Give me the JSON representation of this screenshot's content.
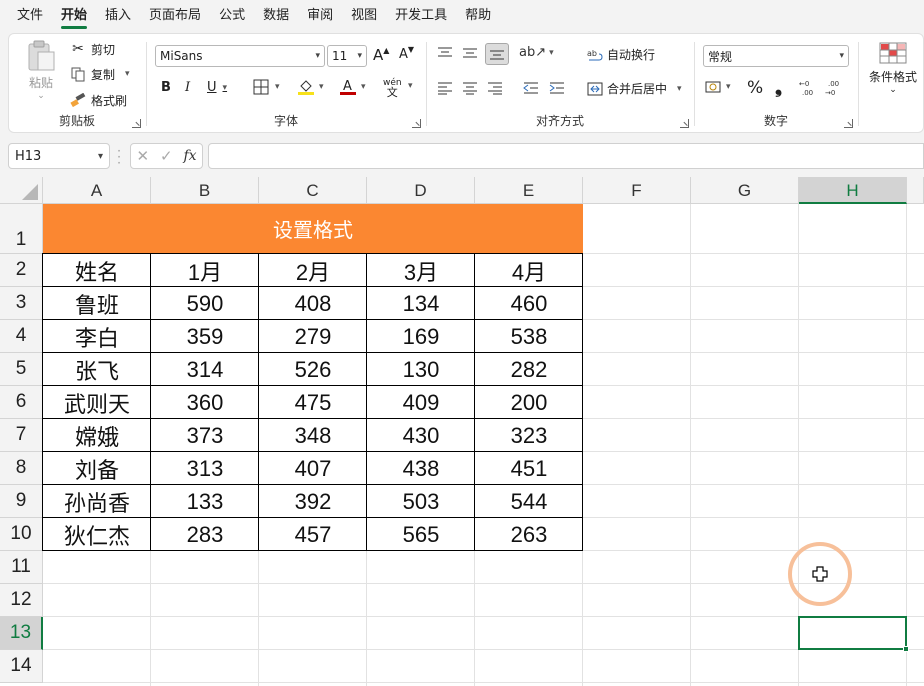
{
  "menu": {
    "items": [
      "文件",
      "开始",
      "插入",
      "页面布局",
      "公式",
      "数据",
      "审阅",
      "视图",
      "开发工具",
      "帮助"
    ],
    "active_index": 1
  },
  "ribbon": {
    "clipboard": {
      "paste": "粘贴",
      "cut": "剪切",
      "copy": "复制",
      "format_painter": "格式刷",
      "label": "剪贴板"
    },
    "font": {
      "font_name": "MiSans",
      "font_size": "11",
      "bold": "B",
      "italic": "I",
      "underline": "U",
      "grow": "A",
      "shrink": "A",
      "phonetic": "wén",
      "label": "字体"
    },
    "alignment": {
      "wrap_text": "自动换行",
      "merge_center": "合并后居中",
      "label": "对齐方式"
    },
    "number": {
      "format": "常规",
      "percent": "%",
      "comma": "❟",
      "label": "数字"
    },
    "styles": {
      "conditional_format": "条件格式"
    }
  },
  "formula_bar": {
    "name_box": "H13",
    "fx": "fx",
    "value": ""
  },
  "sheet": {
    "columns": [
      "A",
      "B",
      "C",
      "D",
      "E",
      "F",
      "G",
      "H"
    ],
    "selected_column": "H",
    "rows": [
      "1",
      "2",
      "3",
      "4",
      "5",
      "6",
      "7",
      "8",
      "9",
      "10",
      "11",
      "12",
      "13",
      "14"
    ],
    "selected_row": "13",
    "title": "设置格式",
    "header": [
      "姓名",
      "1月",
      "2月",
      "3月",
      "4月"
    ],
    "data": [
      [
        "鲁班",
        "590",
        "408",
        "134",
        "460"
      ],
      [
        "李白",
        "359",
        "279",
        "169",
        "538"
      ],
      [
        "张飞",
        "314",
        "526",
        "130",
        "282"
      ],
      [
        "武则天",
        "360",
        "475",
        "409",
        "200"
      ],
      [
        "嫦娥",
        "373",
        "348",
        "430",
        "323"
      ],
      [
        "刘备",
        "313",
        "407",
        "438",
        "451"
      ],
      [
        "孙尚香",
        "133",
        "392",
        "503",
        "544"
      ],
      [
        "狄仁杰",
        "283",
        "457",
        "565",
        "263"
      ]
    ],
    "selected_cell": "H13"
  },
  "colors": {
    "accent": "#107c41",
    "title_fill": "#fb8731",
    "cursor_ring": "#f7c09a"
  },
  "icons": [
    "paste-icon",
    "scissors-icon",
    "copy-icon",
    "brush-icon",
    "borders-icon",
    "fill-color-icon",
    "font-color-icon",
    "align-icon",
    "wrap-icon",
    "merge-icon",
    "currency-icon",
    "cell-cursor-icon"
  ]
}
